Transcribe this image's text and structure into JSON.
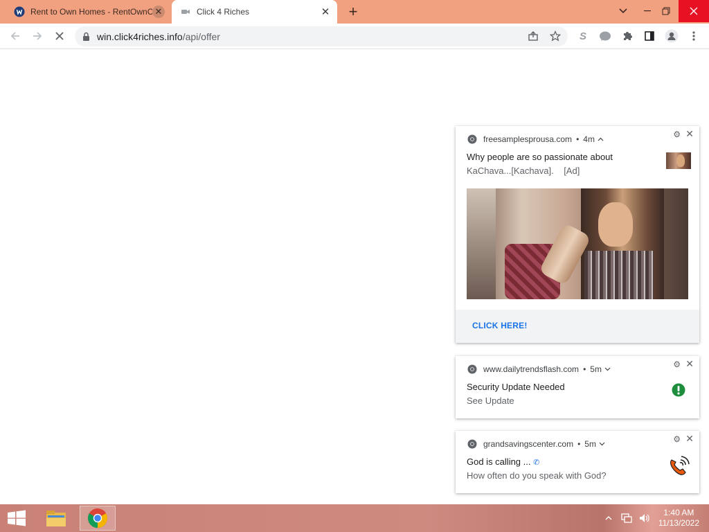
{
  "browser": {
    "tabs": [
      {
        "title": "Rent to Own Homes - RentOwnC",
        "active": false
      },
      {
        "title": "Click 4 Riches",
        "active": true
      }
    ],
    "address": {
      "host": "win.click4riches.info",
      "path": "/api/offer"
    }
  },
  "notifications": [
    {
      "source": "freesamplesprousa.com",
      "age": "4m",
      "title": "Why people are so passionate about",
      "body": "KaChava...[Kachava].    [Ad]",
      "action": "CLICK HERE!",
      "image": "woman-drinking-shake-photo"
    },
    {
      "source": "www.dailytrendsflash.com",
      "age": "5m",
      "title": "Security Update Needed",
      "body": "See Update",
      "icon": "green-alert-icon"
    },
    {
      "source": "grandsavingscenter.com",
      "age": "5m",
      "title": "God is calling ...",
      "body": "How often do you speak with God?",
      "icon": "orange-phone-icon"
    }
  ],
  "taskbar": {
    "clock_time": "1:40 AM",
    "clock_date": "11/13/2022"
  },
  "colors": {
    "tabstrip": "#f1a080",
    "link_blue": "#1a73e8",
    "alert_green": "#1e8e3e",
    "phone_orange": "#e8590c"
  }
}
